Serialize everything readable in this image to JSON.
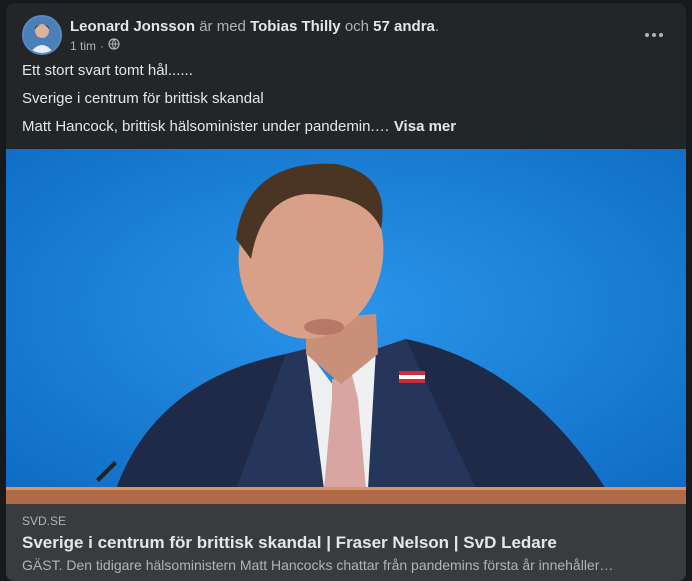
{
  "post": {
    "author": "Leonard Jonsson",
    "with_text": "är med",
    "tagged_person": "Tobias Thilly",
    "and_text": "och",
    "others": "57 andra",
    "period": ".",
    "time": "1 tim",
    "separator": "·",
    "privacy_icon": "globe-icon",
    "more_icon": "more-dots-icon",
    "lines": [
      "Ett stort svart tomt hål......",
      "Sverige i centrum för brittisk skandal",
      "Matt Hancock, brittisk hälsominister under pandemin.…"
    ],
    "see_more": "Visa mer"
  },
  "link": {
    "domain": "SVD.SE",
    "title": "Sverige i centrum för brittisk skandal | Fraser Nelson | SvD Ledare",
    "description": "GÄST. Den tidigare hälsoministern Matt Hancocks chattar från pandemins första år innehåller…"
  },
  "colors": {
    "background": "#18191a",
    "card": "#242526",
    "link_bar": "#3a3b3c",
    "photo_backdrop": "#1a7fd6"
  }
}
